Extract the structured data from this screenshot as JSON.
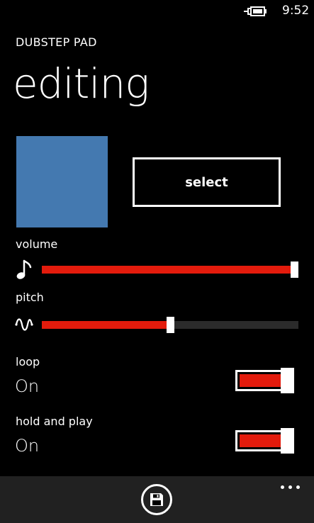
{
  "status_bar": {
    "time": "9:52",
    "battery_icon": "battery-charging-icon"
  },
  "header": {
    "app_title": "DUBSTEP PAD",
    "page_title": "editing"
  },
  "pad": {
    "color": "#4479B0",
    "select_label": "select"
  },
  "volume": {
    "label": "volume",
    "icon": "music-note-icon",
    "value_fraction": 1.0,
    "fill_color": "#E31B0C"
  },
  "pitch": {
    "label": "pitch",
    "icon": "wave-icon",
    "value_fraction": 0.5,
    "fill_color": "#E31B0C"
  },
  "loop": {
    "label": "loop",
    "value": "On",
    "fill_color": "#E31B0C"
  },
  "hold_and_play": {
    "label": "hold and play",
    "value": "On",
    "fill_color": "#E31B0C"
  },
  "app_bar": {
    "background": "#212121",
    "primary_icon": "save-icon",
    "more_icon": "more-icon"
  }
}
